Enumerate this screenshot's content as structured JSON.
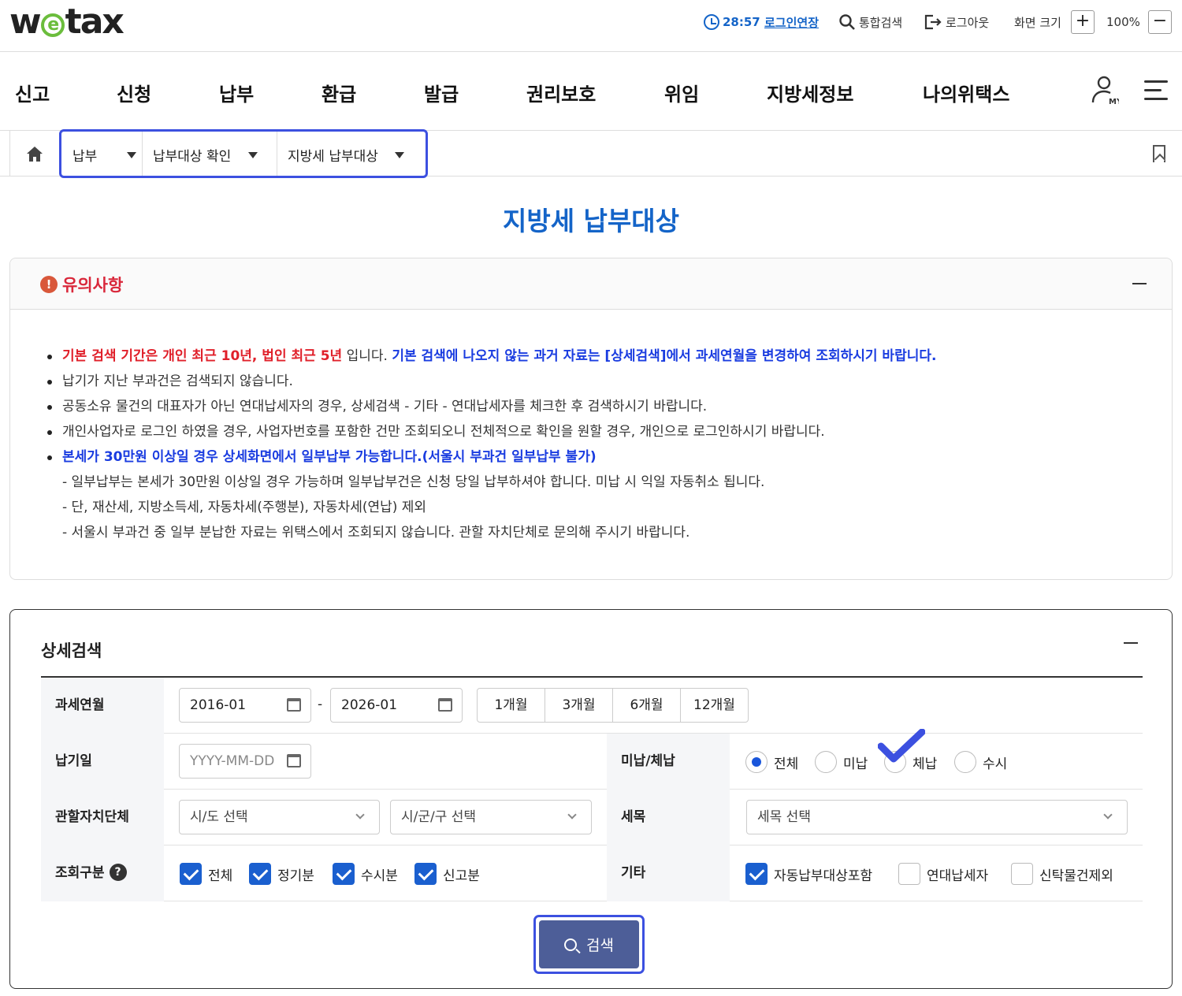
{
  "header": {
    "logo": "wetax",
    "timer": "28:57",
    "extend_login": "로그인연장",
    "search": "통합검색",
    "logout": "로그아웃",
    "zoom_label": "화면 크기",
    "zoom_value": "100%",
    "zoom_in": "+",
    "zoom_out": "−"
  },
  "nav": [
    "신고",
    "신청",
    "납부",
    "환급",
    "발급",
    "권리보호",
    "위임",
    "지방세정보",
    "나의위택스"
  ],
  "my_label": "MY",
  "breadcrumb": [
    "납부",
    "납부대상 확인",
    "지방세 납부대상"
  ],
  "page_title": "지방세 납부대상",
  "notice": {
    "title": "유의사항",
    "line1_red": "기본 검색 기간은 개인 최근 10년, 법인 최근 5년",
    "line1_normal": " 입니다. ",
    "line1_blue": "기본 검색에 나오지 않는 과거 자료는 [상세검색]에서 과세연월을 변경하여 조회하시기 바랍니다.",
    "line2": "납기가 지난 부과건은 검색되지 않습니다.",
    "line3": "공동소유 물건의 대표자가 아닌 연대납세자의 경우, 상세검색 - 기타 - 연대납세자를 체크한 후 검색하시기 바랍니다.",
    "line4": "개인사업자로 로그인 하였을 경우, 사업자번호를 포함한 건만 조회되오니 전체적으로 확인을 원할 경우, 개인으로 로그인하시기 바랍니다.",
    "line5_blue": "본세가 30만원 이상일 경우 상세화면에서 일부납부 가능합니다.(서울시 부과건 일부납부 불가)",
    "sub1": "- 일부납부는 본세가 30만원 이상일 경우 가능하며 일부납부건은 신청 당일 납부하셔야 합니다. 미납 시 익일 자동취소 됩니다.",
    "sub2": "- 단, 재산세, 지방소득세, 자동차세(주행분), 자동차세(연납) 제외",
    "sub3": "- 서울시 부과건 중 일부 분납한 자료는 위택스에서 조회되지 않습니다. 관할 자치단체로 문의해 주시기 바랍니다."
  },
  "search": {
    "title": "상세검색",
    "period_label": "과세연월",
    "from": "2016-01",
    "dash": "-",
    "to": "2026-01",
    "periods": [
      "1개월",
      "3개월",
      "6개월",
      "12개월"
    ],
    "due_label": "납기일",
    "due_placeholder": "YYYY-MM-DD",
    "status_label": "미납/체납",
    "status_options": [
      "전체",
      "미납",
      "체납",
      "수시"
    ],
    "status_selected": "전체",
    "region_label": "관할자치단체",
    "sido_placeholder": "시/도 선택",
    "sigungu_placeholder": "시/군/구 선택",
    "tax_label": "세목",
    "tax_placeholder": "세목 선택",
    "type_label": "조회구분",
    "type_options": [
      "전체",
      "정기분",
      "수시분",
      "신고분"
    ],
    "etc_label": "기타",
    "etc_options": [
      "자동납부대상포함",
      "연대납세자",
      "신탁물건제외"
    ],
    "button": "검색"
  },
  "colors": {
    "brand_blue": "#1464c8",
    "highlight": "#3c50e0",
    "warning_red": "#e0202a",
    "button": "#4d5e98"
  }
}
